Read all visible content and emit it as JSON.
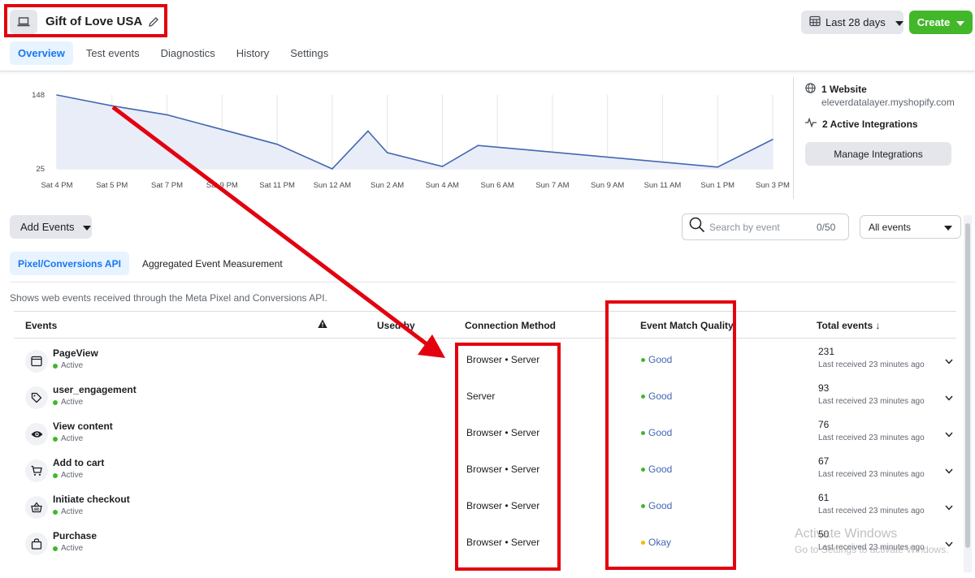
{
  "header": {
    "title": "Gift of Love USA",
    "date_range": "Last 28 days",
    "create_label": "Create",
    "tabs": [
      {
        "label": "Overview",
        "active": true
      },
      {
        "label": "Test events"
      },
      {
        "label": "Diagnostics"
      },
      {
        "label": "History"
      },
      {
        "label": "Settings"
      }
    ]
  },
  "chart_data": {
    "type": "area",
    "y_ticks": [
      "148",
      "25"
    ],
    "ylim": [
      25,
      148
    ],
    "x_labels": [
      "Sat 4 PM",
      "Sat 5 PM",
      "Sat 7 PM",
      "Sat 9 PM",
      "Sat 11 PM",
      "Sun 12 AM",
      "Sun 2 AM",
      "Sun 4 AM",
      "Sun 6 AM",
      "Sun 7 AM",
      "Sun 9 AM",
      "Sun 11 AM",
      "Sun 1 PM",
      "Sun 3 PM"
    ],
    "points": [
      {
        "x": "Sat 4 PM",
        "y": 148
      },
      {
        "x": "Sat 5 PM",
        "y": 130
      },
      {
        "x": "Sat 7 PM",
        "y": 115
      },
      {
        "x": "Sat 11 PM",
        "y": 66
      },
      {
        "x": "Sun 12 AM",
        "y": 25
      },
      {
        "x": "Sun 12 AM+",
        "y": 88
      },
      {
        "x": "Sun 2 AM",
        "y": 52
      },
      {
        "x": "Sun 4 AM",
        "y": 29
      },
      {
        "x": "Sun 4 AM+",
        "y": 64
      },
      {
        "x": "Sun 1 PM",
        "y": 28
      },
      {
        "x": "Sun 3 PM",
        "y": 74
      }
    ],
    "color": "#4267b2",
    "fill": "#e9edf8"
  },
  "side_panel": {
    "websites": "1 Website",
    "domain": "eleverdatalayer.myshopify.com",
    "integrations": "2 Active Integrations",
    "manage_label": "Manage Integrations"
  },
  "controls": {
    "add_events": "Add Events",
    "search_placeholder": "Search by event",
    "search_count": "0/50",
    "filter_label": "All events",
    "subtabs": [
      {
        "label": "Pixel/Conversions API",
        "active": true
      },
      {
        "label": "Aggregated Event Measurement"
      }
    ],
    "description": "Shows web events received through the Meta Pixel and Conversions API."
  },
  "table": {
    "headers": {
      "events": "Events",
      "used_by": "Used by",
      "connection": "Connection Method",
      "quality": "Event Match Quality",
      "total": "Total events ↓"
    },
    "rows": [
      {
        "icon": "browser-window-icon",
        "name": "PageView",
        "status": "Active",
        "connection": "Browser • Server",
        "quality": "Good",
        "total": "231",
        "last": "Last received 23 minutes ago"
      },
      {
        "icon": "tag-icon",
        "name": "user_engagement",
        "status": "Active",
        "connection": "Server",
        "quality": "Good",
        "total": "93",
        "last": "Last received 23 minutes ago"
      },
      {
        "icon": "eye-icon",
        "name": "View content",
        "status": "Active",
        "connection": "Browser • Server",
        "quality": "Good",
        "total": "76",
        "last": "Last received 23 minutes ago"
      },
      {
        "icon": "cart-icon",
        "name": "Add to cart",
        "status": "Active",
        "connection": "Browser • Server",
        "quality": "Good",
        "total": "67",
        "last": "Last received 23 minutes ago"
      },
      {
        "icon": "basket-icon",
        "name": "Initiate checkout",
        "status": "Active",
        "connection": "Browser • Server",
        "quality": "Good",
        "total": "61",
        "last": "Last received 23 minutes ago"
      },
      {
        "icon": "shopping-bag-icon",
        "name": "Purchase",
        "status": "Active",
        "connection": "Browser • Server",
        "quality": "Okay",
        "total": "50",
        "last": "Last received 23 minutes ago"
      }
    ]
  },
  "colors": {
    "active": "#42b72a",
    "good": "#42b72a",
    "okay": "#f5b800",
    "annotation": "#e3000f"
  },
  "watermark": {
    "line1": "Activate Windows",
    "line2": "Go to Settings to activate Windows."
  }
}
